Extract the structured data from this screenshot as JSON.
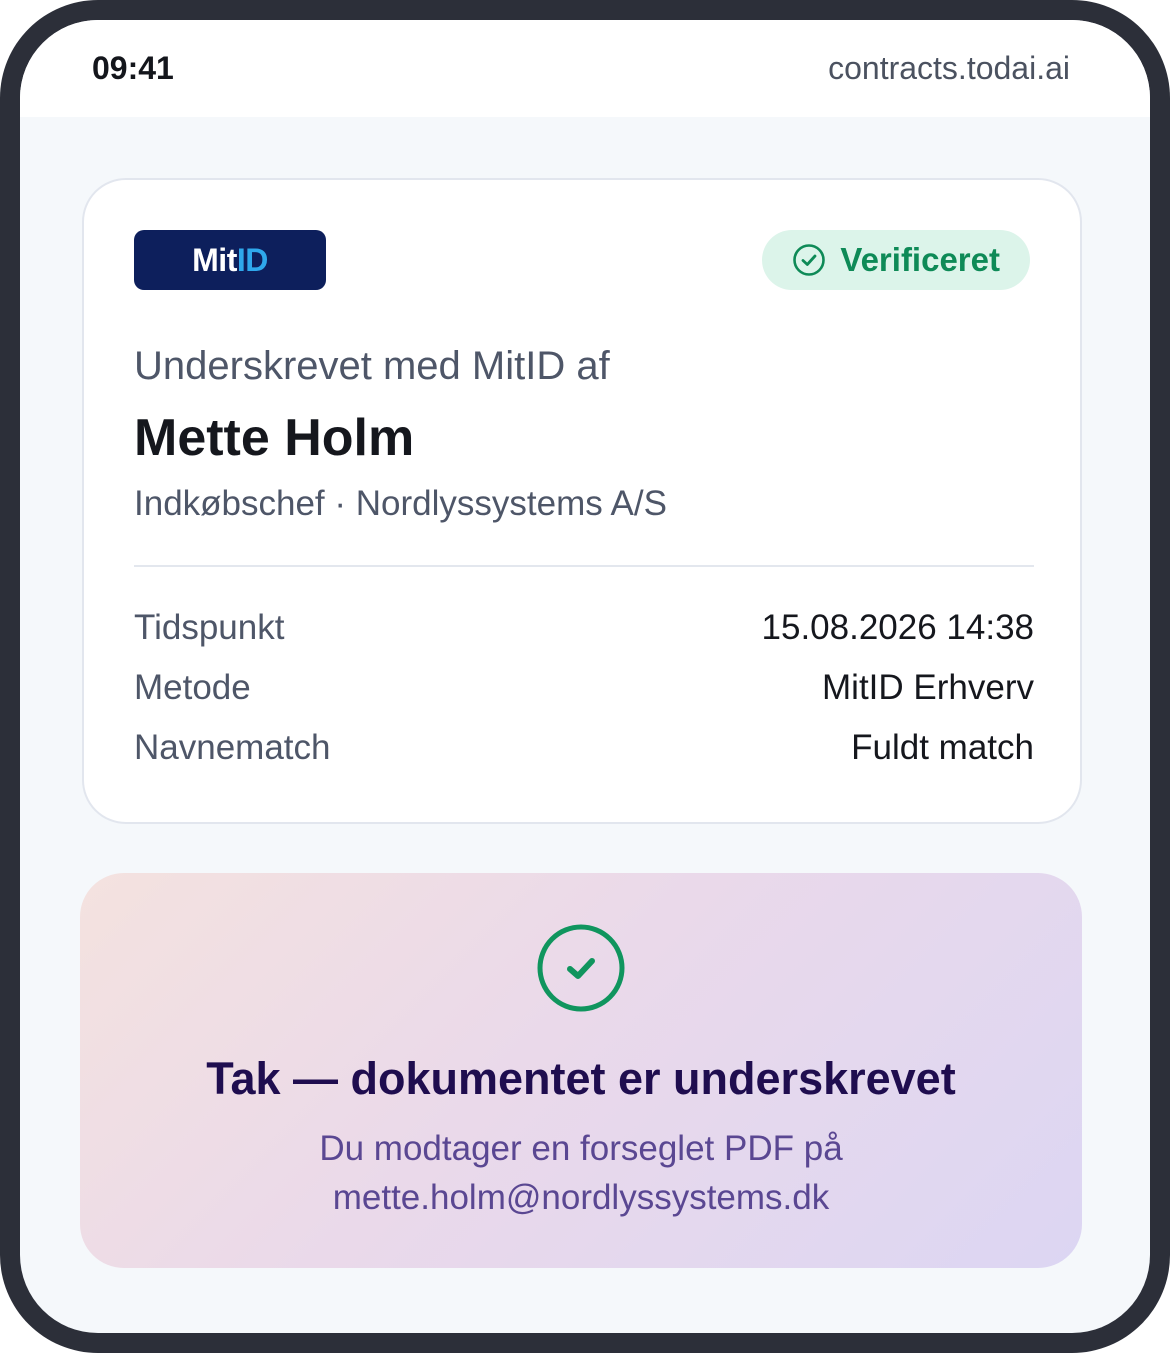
{
  "status_bar": {
    "time": "09:41",
    "url": "contracts.todai.ai"
  },
  "signature_card": {
    "logo": {
      "part1": "Mit",
      "part2": "ID"
    },
    "badge": {
      "icon": "check-circle-icon",
      "label": "Verificeret"
    },
    "signed_by_label": "Underskrevet med MitID af",
    "signer_name": "Mette Holm",
    "signer_role": "Indkøbschef · Nordlyssystems A/S",
    "details": [
      {
        "key": "Tidspunkt",
        "value": "15.08.2026 14:38"
      },
      {
        "key": "Metode",
        "value": "MitID Erhverv"
      },
      {
        "key": "Navnematch",
        "value": "Fuldt match"
      }
    ]
  },
  "confirmation": {
    "icon": "check-circle-icon",
    "title": "Tak — dokumentet er underskrevet",
    "message_line1": "Du modtager en forseglet PDF på",
    "message_line2": "mette.holm@nordlyssystems.dk"
  },
  "colors": {
    "frame": "#2c2f39",
    "mitid_navy": "#0d1f5c",
    "mitid_blue": "#2fa8ec",
    "verified_green": "#0e8a57",
    "verified_bg": "#dcf4ea",
    "success_title": "#1f0d4f",
    "success_text": "#5a4792"
  }
}
